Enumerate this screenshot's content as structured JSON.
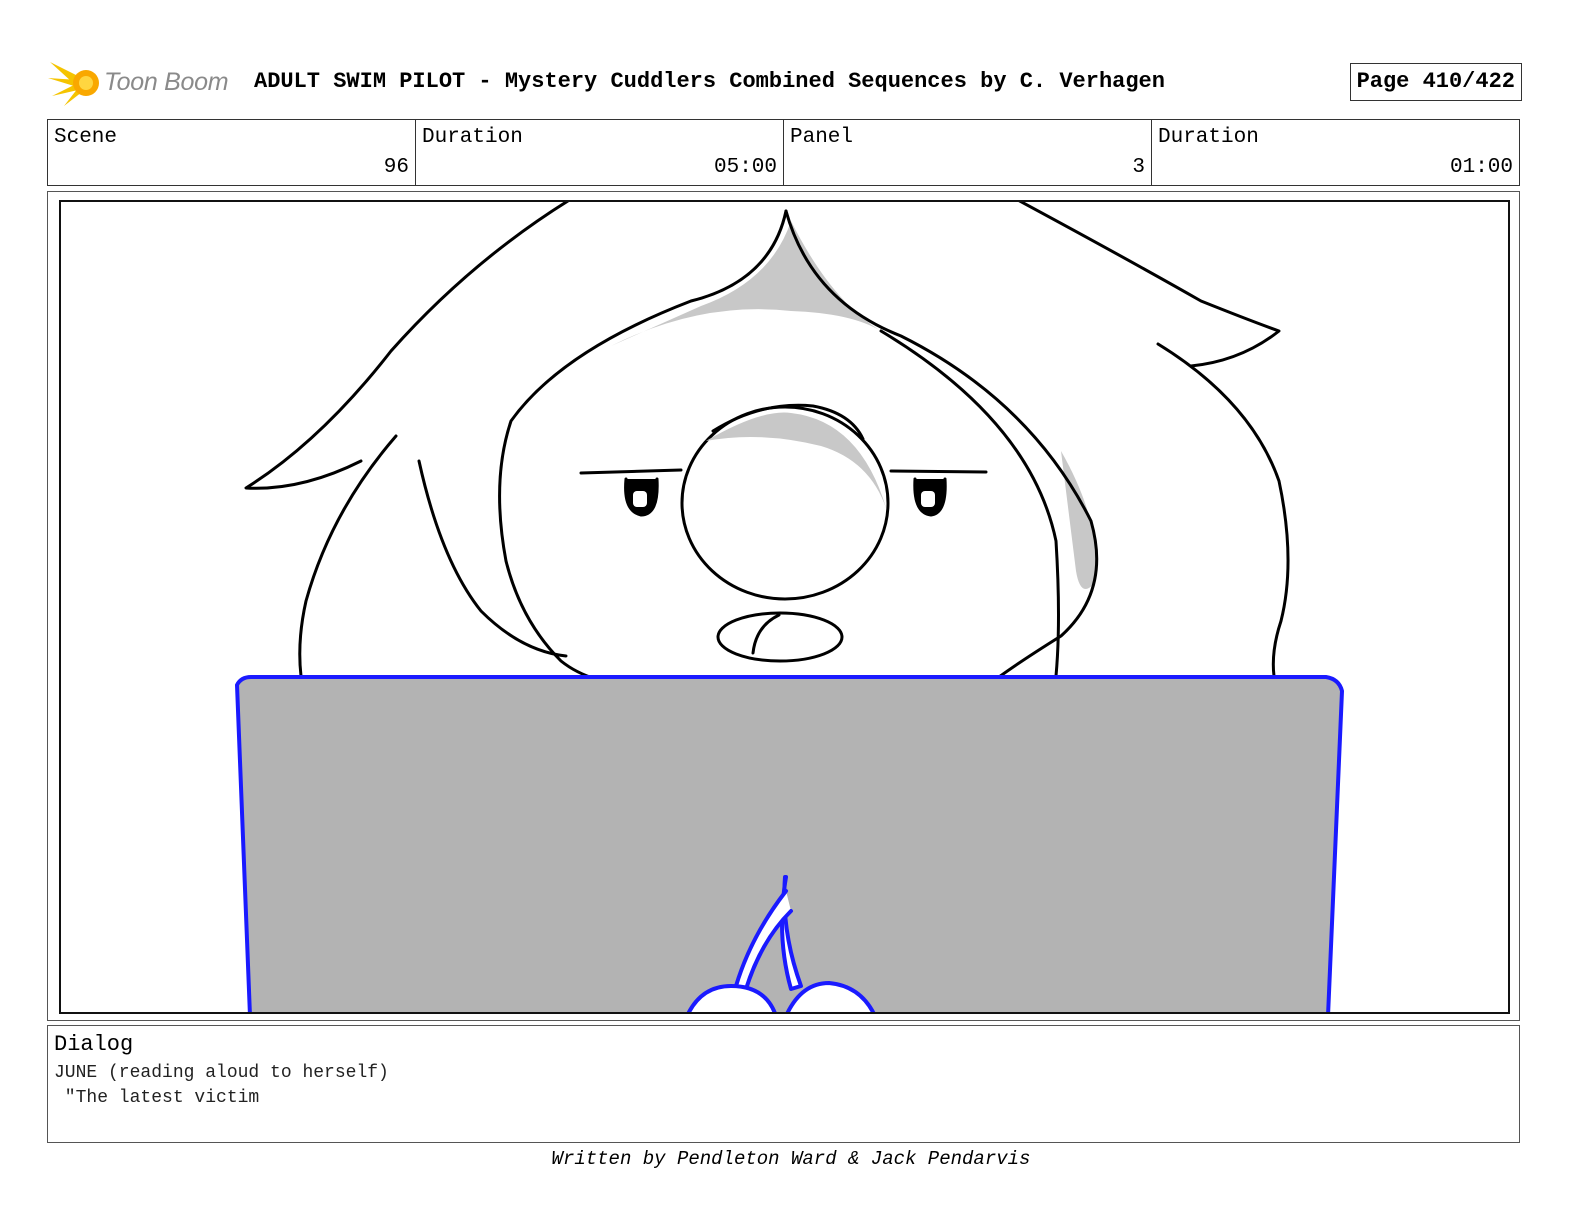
{
  "header": {
    "logo_text": "Toon Boom",
    "title": "ADULT SWIM PILOT - Mystery Cuddlers   Combined Sequences by C. Verhagen",
    "page": "Page 410/422"
  },
  "info": {
    "scene_label": "Scene",
    "scene_value": "96",
    "scene_duration_label": "Duration",
    "scene_duration_value": "05:00",
    "panel_label": "Panel",
    "panel_value": "3",
    "panel_duration_label": "Duration",
    "panel_duration_value": "01:00"
  },
  "panel_image": {
    "icon": "storyboard-drawing",
    "colors": {
      "outline": "#000000",
      "laptop_outline": "#1a1aff",
      "laptop_fill": "#b3b3b3",
      "shade": "#c8c8c8"
    }
  },
  "dialog": {
    "title": "Dialog",
    "line1": "JUNE (reading aloud to herself)",
    "line2": " \"The latest victim"
  },
  "footer": {
    "credit": "Written by Pendleton Ward & Jack Pendarvis"
  }
}
